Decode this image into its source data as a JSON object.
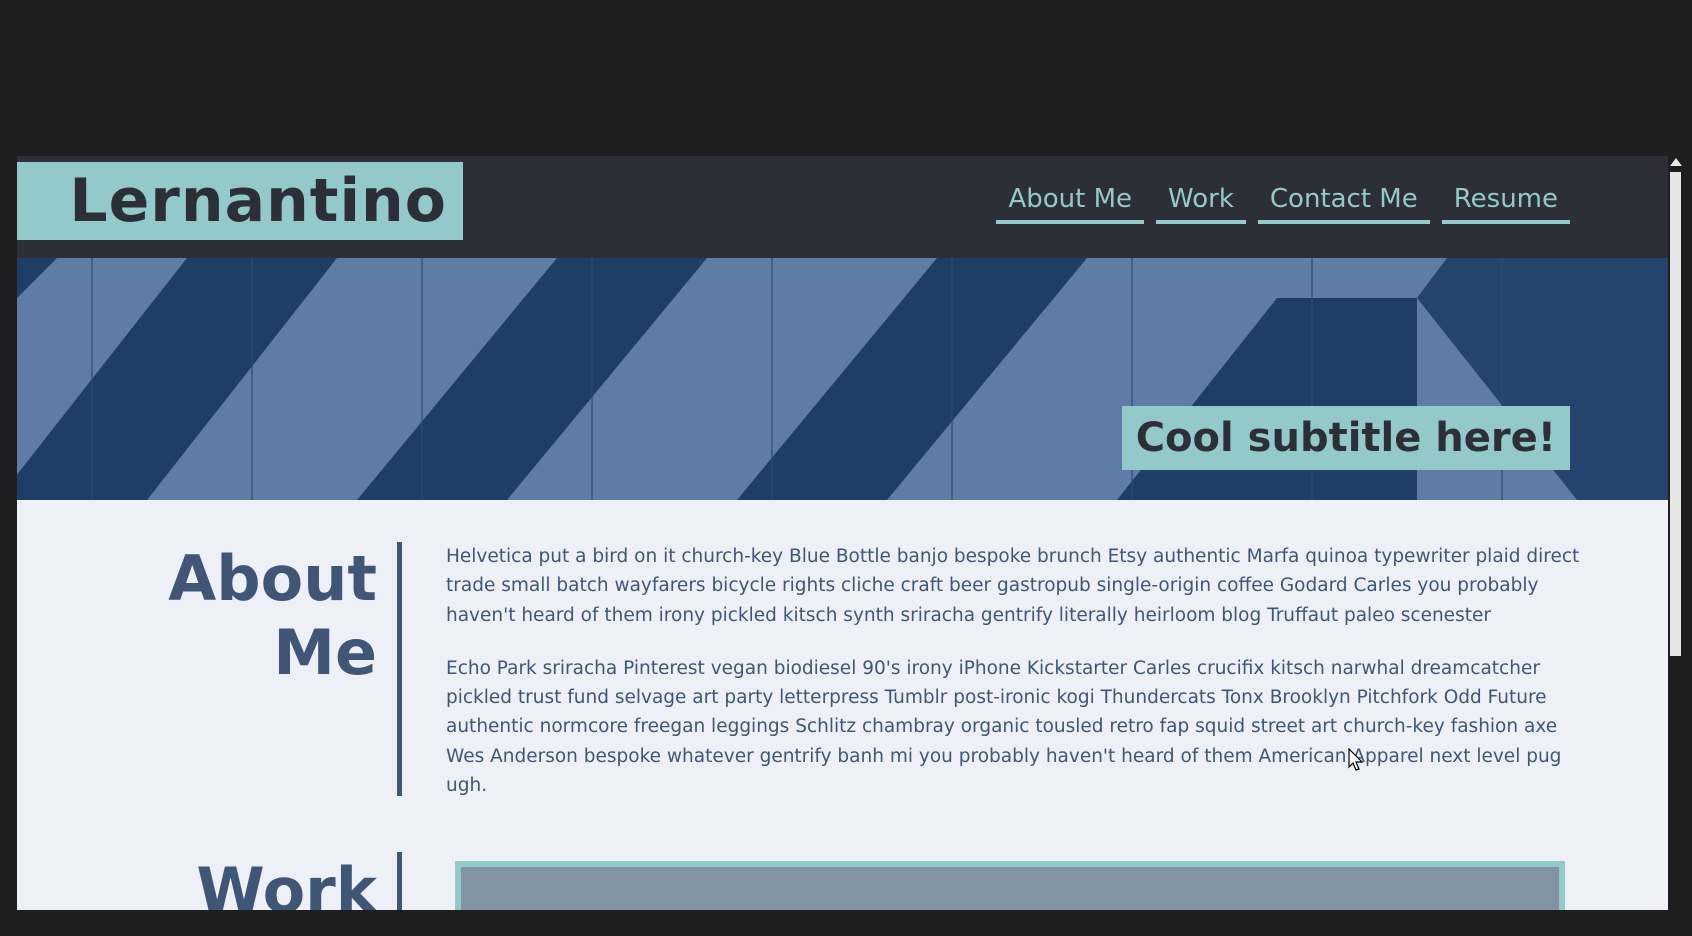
{
  "site": {
    "logo": "Lernantino",
    "nav": [
      {
        "label": "About Me"
      },
      {
        "label": "Work"
      },
      {
        "label": "Contact Me"
      },
      {
        "label": "Resume"
      }
    ],
    "subtitle": "Cool subtitle here!"
  },
  "about": {
    "heading": "About Me",
    "paragraphs": [
      "Helvetica put a bird on it church-key Blue Bottle banjo bespoke brunch Etsy authentic Marfa quinoa typewriter plaid direct trade small batch wayfarers bicycle rights cliche craft beer gastropub single-origin coffee Godard Carles you probably haven't heard of them irony pickled kitsch synth sriracha gentrify literally heirloom blog Truffaut paleo scenester",
      "Echo Park sriracha Pinterest vegan biodiesel 90's irony iPhone Kickstarter Carles crucifix kitsch narwhal dreamcatcher pickled trust fund selvage art party letterpress Tumblr post-ironic kogi Thundercats Tonx Brooklyn Pitchfork Odd Future authentic normcore freegan leggings Schlitz chambray organic tousled retro fap squid street art church-key fashion axe Wes Anderson bespoke whatever gentrify banh mi you probably haven't heard of them American Apparel next level pug ugh."
    ]
  },
  "work": {
    "heading": "Work"
  },
  "colors": {
    "header_bg": "#2d2f38",
    "accent": "#93cac9",
    "heading_text": "#3f5677",
    "page_bg": "#eef0f8",
    "hero_blue": "#5e7ca6",
    "hero_dark": "#1f3e67"
  },
  "icons": {
    "cursor": "mouse-pointer-icon",
    "scroll_up": "chevron-up-icon"
  }
}
